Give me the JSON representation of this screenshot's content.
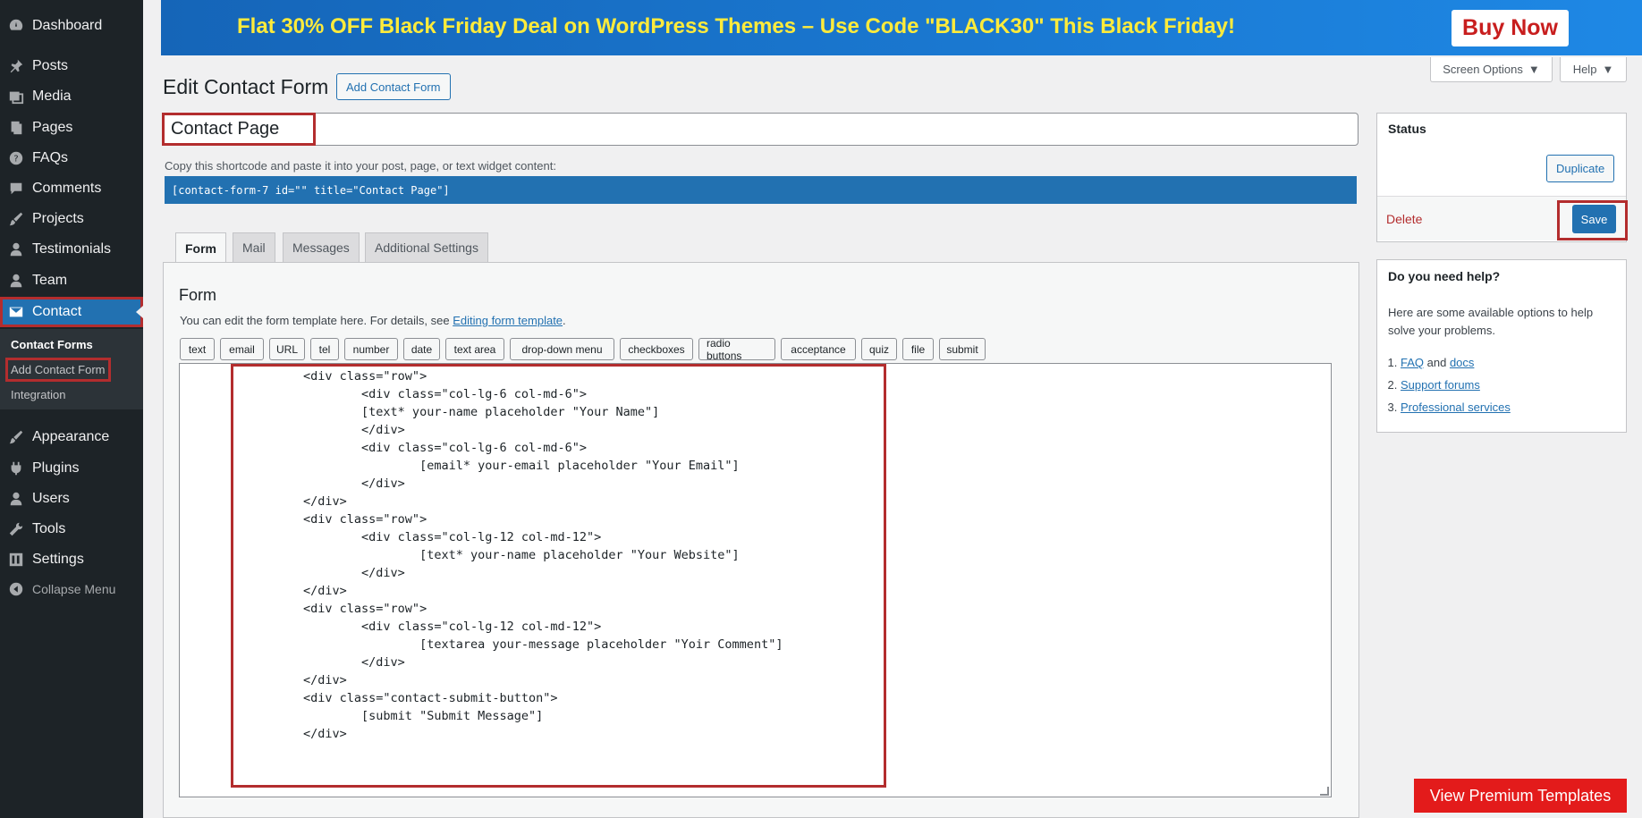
{
  "sidebar": {
    "items": [
      {
        "label": "Dashboard",
        "icon": "dashboard-icon"
      },
      {
        "label": "Posts",
        "icon": "pin-icon"
      },
      {
        "label": "Media",
        "icon": "media-icon"
      },
      {
        "label": "Pages",
        "icon": "pages-icon"
      },
      {
        "label": "FAQs",
        "icon": "question-icon"
      },
      {
        "label": "Comments",
        "icon": "comment-icon"
      },
      {
        "label": "Projects",
        "icon": "brush-icon"
      },
      {
        "label": "Testimonials",
        "icon": "user-icon"
      },
      {
        "label": "Team",
        "icon": "user-icon"
      },
      {
        "label": "Contact",
        "icon": "mail-icon"
      },
      {
        "label": "Appearance",
        "icon": "brush-icon"
      },
      {
        "label": "Plugins",
        "icon": "plug-icon"
      },
      {
        "label": "Users",
        "icon": "user-icon"
      },
      {
        "label": "Tools",
        "icon": "wrench-icon"
      },
      {
        "label": "Settings",
        "icon": "settings-icon"
      }
    ],
    "submenu": [
      "Contact Forms",
      "Add Contact Form",
      "Integration"
    ],
    "collapse_label": "Collapse Menu"
  },
  "banner": {
    "promo": "Flat 30% OFF Black Friday Deal on WordPress Themes – Use Code \"BLACK30\" This Black Friday!",
    "buy_label": "Buy Now"
  },
  "top_buttons": {
    "screen_options": "Screen Options",
    "help": "Help"
  },
  "page": {
    "title": "Edit Contact Form",
    "add_new": "Add Contact Form",
    "form_title": "Contact Page",
    "shortcode_hint": "Copy this shortcode and paste it into your post, page, or text widget content:",
    "shortcode": "[contact-form-7 id=\"\" title=\"Contact Page\"]"
  },
  "tabs": [
    "Form",
    "Mail",
    "Messages",
    "Additional Settings"
  ],
  "form_panel": {
    "heading": "Form",
    "desc_prefix": "You can edit the form template here. For details, see ",
    "desc_link": "Editing form template",
    "desc_suffix": ".",
    "tag_buttons": [
      "text",
      "email",
      "URL",
      "tel",
      "number",
      "date",
      "text area",
      "drop-down menu",
      "checkboxes",
      "radio buttons",
      "acceptance",
      "quiz",
      "file",
      "submit"
    ],
    "code": "        <div class=\"row\">\n                <div class=\"col-lg-6 col-md-6\">\n                [text* your-name placeholder \"Your Name\"]\n                </div>\n                <div class=\"col-lg-6 col-md-6\">\n                        [email* your-email placeholder \"Your Email\"]\n                </div>\n        </div>\n        <div class=\"row\">\n                <div class=\"col-lg-12 col-md-12\">\n                        [text* your-name placeholder \"Your Website\"]\n                </div>\n        </div>\n        <div class=\"row\">\n                <div class=\"col-lg-12 col-md-12\">\n                        [textarea your-message placeholder \"Yoir Comment\"]\n                </div>\n        </div>\n        <div class=\"contact-submit-button\">\n                [submit \"Submit Message\"]\n        </div>"
  },
  "status_box": {
    "heading": "Status",
    "duplicate": "Duplicate",
    "delete": "Delete",
    "save": "Save"
  },
  "help_box": {
    "heading": "Do you need help?",
    "text": "Here are some available options to help solve your problems.",
    "item1_link1": "FAQ",
    "item1_and": " and ",
    "item1_link2": "docs",
    "item2": "Support forums",
    "item3": "Professional services"
  },
  "premium_button": "View Premium Templates",
  "colors": {
    "accent": "#2271b1",
    "highlight": "#b32d2e",
    "promo_text": "#ffeb3b",
    "premium": "#e31b1b"
  }
}
